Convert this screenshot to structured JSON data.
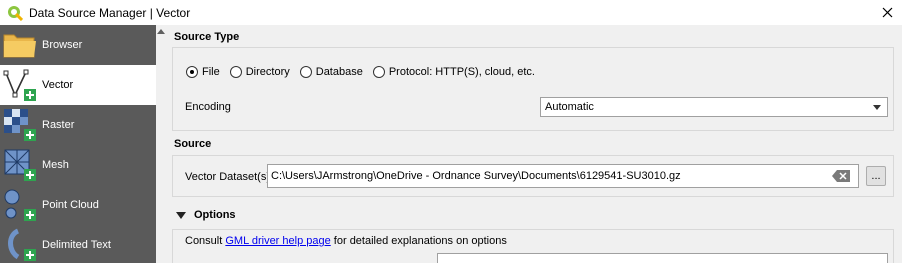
{
  "window": {
    "title": "Data Source Manager | Vector"
  },
  "sidebar": {
    "items": [
      {
        "label": "Browser",
        "icon": "folder-icon"
      },
      {
        "label": "Vector",
        "icon": "vector-icon"
      },
      {
        "label": "Raster",
        "icon": "raster-icon"
      },
      {
        "label": "Mesh",
        "icon": "mesh-icon"
      },
      {
        "label": "Point Cloud",
        "icon": "point-cloud-icon"
      },
      {
        "label": "Delimited Text",
        "icon": "delimited-text-icon"
      }
    ],
    "active": "Vector"
  },
  "source_type": {
    "title": "Source Type",
    "options": [
      "File",
      "Directory",
      "Database",
      "Protocol: HTTP(S), cloud, etc."
    ],
    "selected": "File",
    "encoding_label": "Encoding",
    "encoding_value": "Automatic"
  },
  "source": {
    "title": "Source",
    "dataset_label": "Vector Dataset(s)",
    "dataset_value": "C:\\Users\\JArmstrong\\OneDrive - Ordnance Survey\\Documents\\6129541-SU3010.gz",
    "browse_label": "..."
  },
  "options": {
    "title": "Options",
    "consult_prefix": "Consult",
    "link_text": "GML driver help page",
    "consult_suffix": "for detailed explanations on options"
  },
  "colors": {
    "sidebar_bg": "#5a5a5a",
    "active_bg": "#ffffff",
    "accent_green": "#2ea44f",
    "link": "#0000ee"
  }
}
